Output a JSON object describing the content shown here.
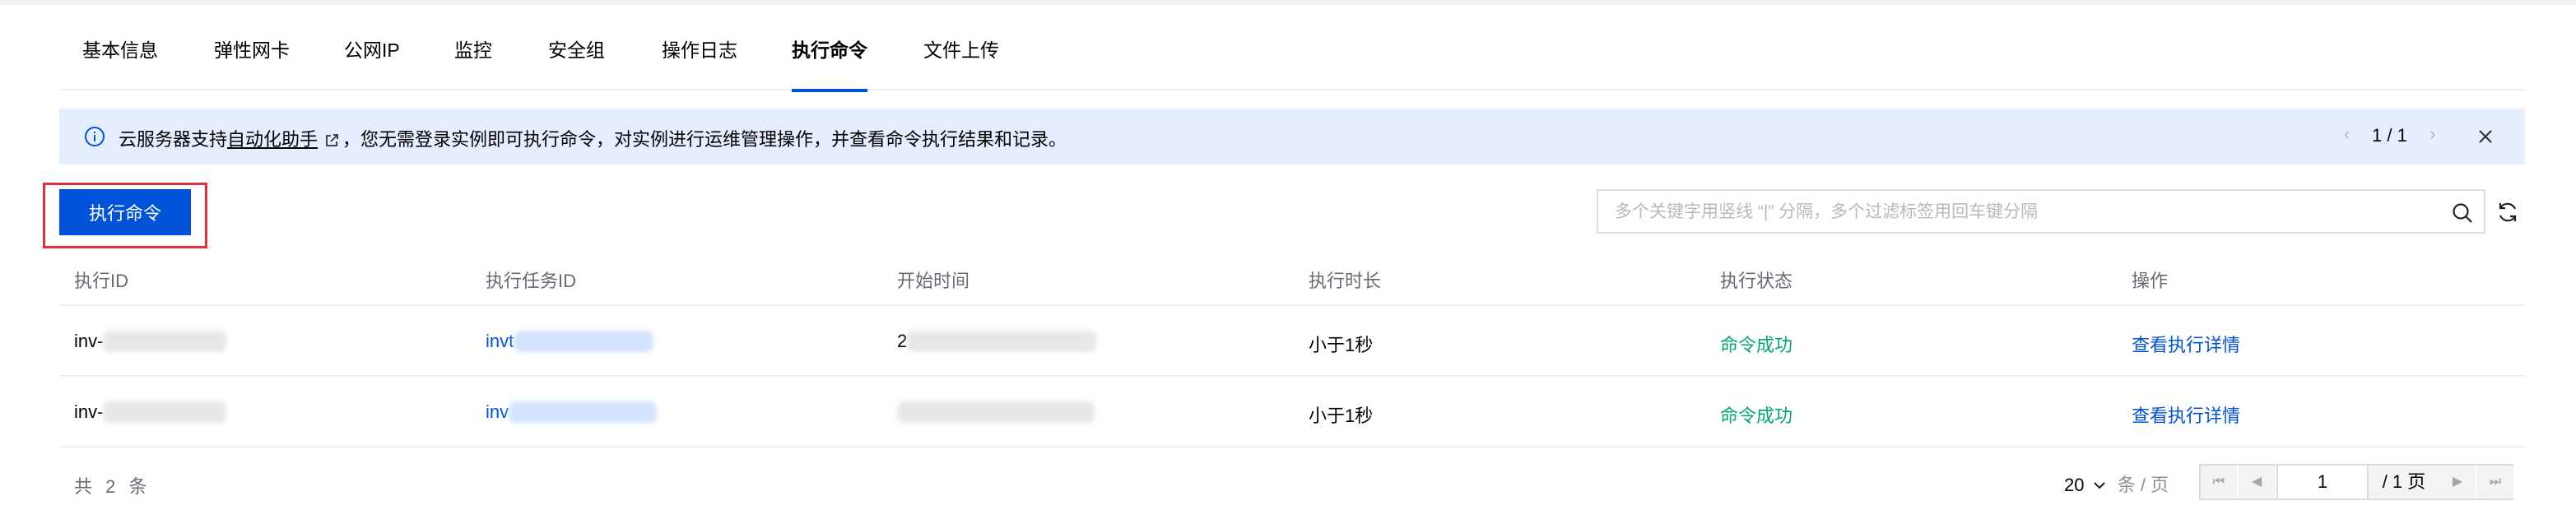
{
  "tabs": [
    {
      "label": "基本信息"
    },
    {
      "label": "弹性网卡"
    },
    {
      "label": "公网IP"
    },
    {
      "label": "监控"
    },
    {
      "label": "安全组"
    },
    {
      "label": "操作日志"
    },
    {
      "label": "执行命令",
      "active": true
    },
    {
      "label": "文件上传"
    }
  ],
  "notice": {
    "text_before": "云服务器支持",
    "link_text": "自动化助手",
    "text_after": "，您无需登录实例即可执行命令，对实例进行运维管理操作，并查看命令执行结果和记录。",
    "pager": "1 / 1"
  },
  "toolbar": {
    "run_button_label": "执行命令",
    "search_placeholder": "多个关键字用竖线 “|” 分隔，多个过滤标签用回车键分隔"
  },
  "table": {
    "columns": [
      "执行ID",
      "执行任务ID",
      "开始时间",
      "执行时长",
      "执行状态",
      "操作"
    ],
    "rows": [
      {
        "exec_id": "inv-",
        "task_id": "invt",
        "start_time": "2",
        "duration": "小于1秒",
        "status": "命令成功",
        "action": "查看执行详情"
      },
      {
        "exec_id": "inv-",
        "task_id": "inv",
        "start_time": "",
        "duration": "小于1秒",
        "status": "命令成功",
        "action": "查看执行详情"
      }
    ]
  },
  "footer": {
    "total": "共 2 条",
    "page_size": "20",
    "page_size_unit": "条 / 页",
    "current_page": "1",
    "total_pages": "/ 1 页"
  },
  "colors": {
    "primary": "#0052d9",
    "success": "#00a870",
    "notice_bg": "#e5eeff",
    "highlight_border": "#e0303a"
  },
  "icons": [
    "info-icon",
    "external-link-icon",
    "chevron-left-icon",
    "chevron-right-icon",
    "close-icon",
    "search-icon",
    "refresh-icon",
    "chevron-down-icon",
    "first-page-icon",
    "prev-page-icon",
    "next-page-icon",
    "last-page-icon"
  ]
}
